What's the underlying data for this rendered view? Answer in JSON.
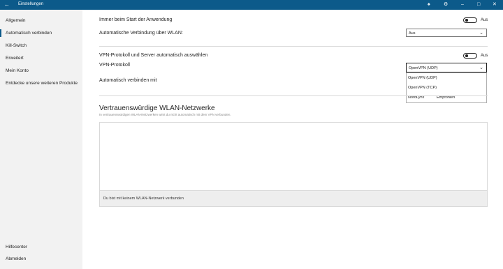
{
  "window": {
    "title": "Einstellungen",
    "back_icon": "back-arrow-icon",
    "actions": [
      "bell-icon",
      "gear-icon",
      "minimize-icon",
      "maximize-icon",
      "close-icon"
    ]
  },
  "sidebar": {
    "items": [
      {
        "label": "Allgemein"
      },
      {
        "label": "Automatisch verbinden",
        "active": true
      },
      {
        "label": "Kill-Switch"
      },
      {
        "label": "Erweitert"
      },
      {
        "label": "Mein Konto"
      },
      {
        "label": "Entdecke unsere weiteren Produkte"
      }
    ],
    "bottom": [
      {
        "label": "Hilfecenter"
      },
      {
        "label": "Abmelden"
      }
    ]
  },
  "settings": {
    "startup_label": "Immer beim Start der Anwendung",
    "startup_toggle": "Aus",
    "wifi_label": "Automatische Verbindung über WLAN:",
    "wifi_select": "Aus",
    "vpn_auto_label": "VPN-Protokoll und Server automatisch auswählen",
    "vpn_auto_toggle": "Aus",
    "protocol_label": "VPN-Protokoll",
    "protocol_select": "OpenVPN (UDP)",
    "connect_with_label": "Automatisch verbinden mit",
    "protocol_options": [
      {
        "label": "OpenVPN (UDP)"
      },
      {
        "label": "OpenVPN (TCP)"
      },
      {
        "label": "NordLynx",
        "tag": "Empfohlen"
      }
    ]
  },
  "trusted": {
    "title": "Vertrauenswürdige WLAN-Netzwerke",
    "subtitle": "In vertrauenswürdigen WLAN-Netzwerken wirst du nicht automatisch mit dem VPN verbunden.",
    "status": "Du bist mit keinem WLAN-Netzwerk verbunden"
  },
  "colors": {
    "accent": "#0c5a8a",
    "sidebar": "#f2f2f2"
  }
}
